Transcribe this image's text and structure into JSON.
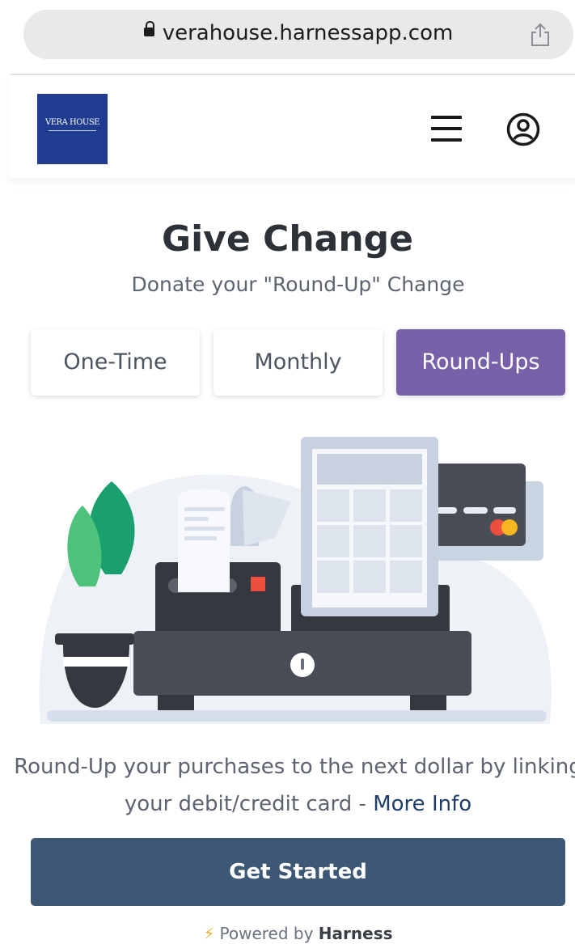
{
  "browser": {
    "url": "verahouse.harnessapp.com"
  },
  "header": {
    "logo_text": "VERA HOUSE"
  },
  "main": {
    "title": "Give Change",
    "subtitle": "Donate your \"Round-Up\" Change",
    "tabs": [
      {
        "label": "One-Time",
        "active": false
      },
      {
        "label": "Monthly",
        "active": false
      },
      {
        "label": "Round-Ups",
        "active": true
      }
    ],
    "description": "Round-Up your purchases to the next dollar by linking your debit/credit card - ",
    "more_info": "More Info",
    "cta": "Get Started"
  },
  "footer": {
    "powered_prefix": "Powered by",
    "powered_brand": "Harness"
  },
  "colors": {
    "active_tab": "#7861a8",
    "cta": "#3d5875",
    "link": "#1e3d69",
    "logo_bg": "#1f3c91"
  },
  "icons": [
    "lock-icon",
    "share-icon",
    "hamburger-menu-icon",
    "user-account-icon",
    "bolt-icon"
  ]
}
